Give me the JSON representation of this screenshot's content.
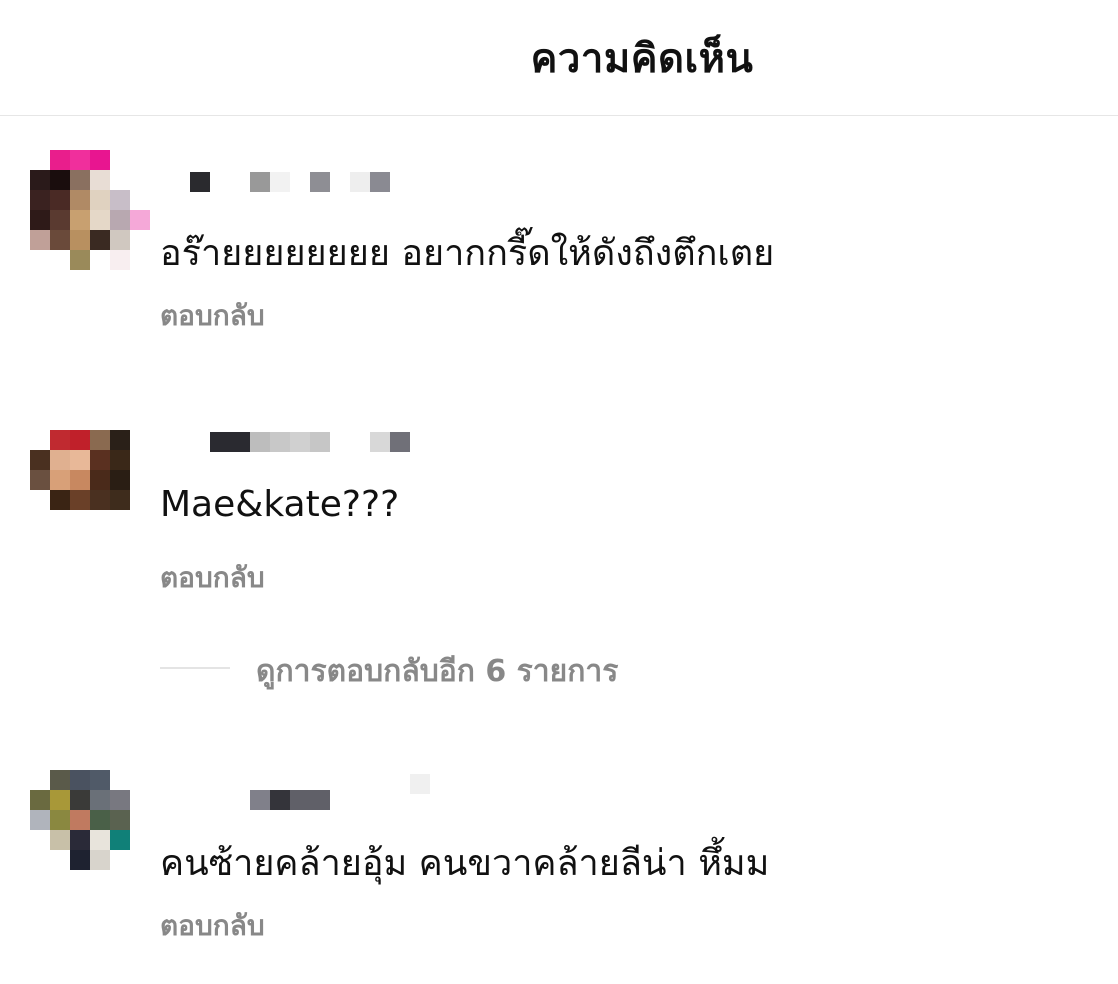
{
  "header": {
    "title": "ความคิดเห็น"
  },
  "comments": [
    {
      "text": "อร๊ายยยยยยยย อยากกรี๊ดให้ดังถึงตึกเตย",
      "reply_label": "ตอบกลับ"
    },
    {
      "text": "Mae&kate???",
      "reply_label": "ตอบกลับ",
      "view_replies_label": "ดูการตอบกลับอีก 6 รายการ"
    },
    {
      "text": "คนซ้ายคล้ายอุ้ม คนขวาคล้ายลีน่า หึ้มม",
      "reply_label": "ตอบกลับ"
    }
  ],
  "colors": {
    "text_primary": "#111111",
    "text_secondary": "#888888",
    "divider": "#e6e6e6"
  }
}
